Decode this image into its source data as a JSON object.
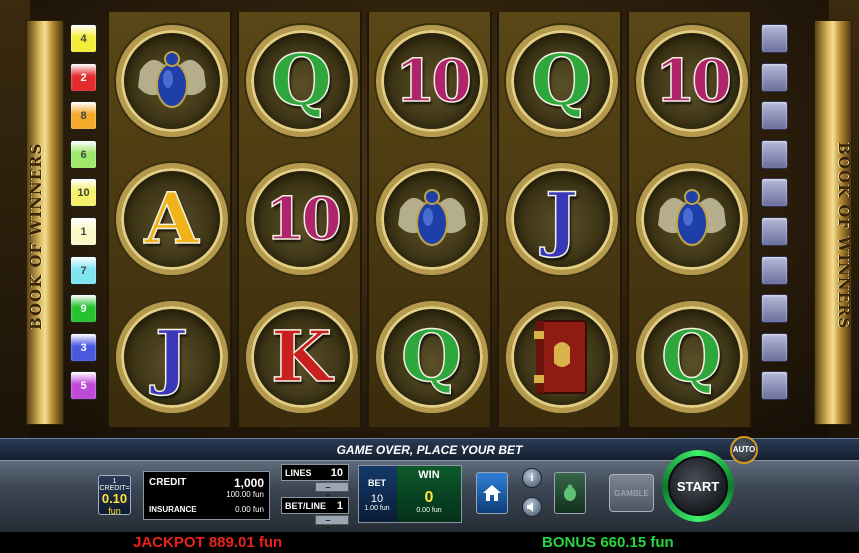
{
  "game": {
    "side_title": "BOOK OF WINNERS",
    "message": "GAME OVER, PLACE YOUR BET"
  },
  "line_indicators_left": [
    {
      "label": "4",
      "color": "#f3ee3a"
    },
    {
      "label": "2",
      "color": "#e52b2b"
    },
    {
      "label": "8",
      "color": "#f4a92a"
    },
    {
      "label": "6",
      "color": "#9ee86a"
    },
    {
      "label": "10",
      "color": "#f6f06a"
    },
    {
      "label": "1",
      "color": "#fbf9c8"
    },
    {
      "label": "7",
      "color": "#7fe5f0"
    },
    {
      "label": "9",
      "color": "#27c22f"
    },
    {
      "label": "3",
      "color": "#4a58e0"
    },
    {
      "label": "5",
      "color": "#c04ad8"
    }
  ],
  "line_indicators_right_count": 10,
  "reels": [
    [
      {
        "symbol": "scarab"
      },
      {
        "symbol": "A",
        "color": "#f0b41a"
      },
      {
        "symbol": "J",
        "color": "#3a38b8"
      }
    ],
    [
      {
        "symbol": "Q",
        "color": "#2ea83c"
      },
      {
        "symbol": "10",
        "color": "#b0246c"
      },
      {
        "symbol": "K",
        "color": "#c81f1f"
      }
    ],
    [
      {
        "symbol": "10",
        "color": "#b0246c"
      },
      {
        "symbol": "scarab"
      },
      {
        "symbol": "Q",
        "color": "#2ea83c"
      }
    ],
    [
      {
        "symbol": "Q",
        "color": "#2ea83c"
      },
      {
        "symbol": "J",
        "color": "#3a38b8"
      },
      {
        "symbol": "book"
      }
    ],
    [
      {
        "symbol": "10",
        "color": "#b0246c"
      },
      {
        "symbol": "scarab"
      },
      {
        "symbol": "Q",
        "color": "#2ea83c"
      }
    ]
  ],
  "denomination": {
    "line1": "1 CREDIT=",
    "value": "0.10",
    "unit": "fun"
  },
  "credit": {
    "label": "CREDIT",
    "value": "1,000",
    "fun_value": "100.00 fun",
    "insurance_label": "INSURANCE",
    "insurance_value": "0.00 fun"
  },
  "lines": {
    "label": "LINES",
    "value": "10"
  },
  "bet_line": {
    "label": "BET/LINE",
    "value": "1"
  },
  "stepper": {
    "symbols": "– +"
  },
  "bet": {
    "label": "BET",
    "value": "10",
    "fun": "1.00 fun"
  },
  "win": {
    "label": "WIN",
    "value": "0",
    "fun": "0.00 fun"
  },
  "buttons": {
    "info": "i",
    "gamble": "GAMBLE",
    "start": "START",
    "auto": "AUTO"
  },
  "jackpot": "JACKPOT 889.01 fun",
  "bonus": "BONUS 660.15 fun",
  "colors": {
    "panel": "#3b4552",
    "message_bar": "#1f2d42",
    "start_ring": "#3ff06a",
    "jackpot": "#e8231c",
    "bonus": "#27d640"
  }
}
